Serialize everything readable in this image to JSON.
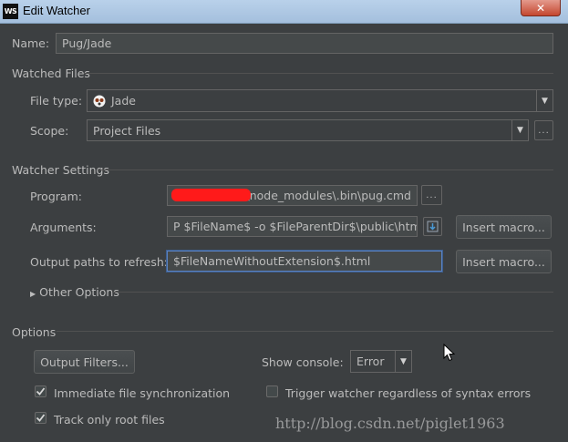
{
  "window": {
    "title": "Edit Watcher",
    "app_icon_text": "WS",
    "close_glyph": "✕"
  },
  "name": {
    "label": "Name:",
    "value": "Pug/Jade"
  },
  "watched_files": {
    "section": "Watched Files",
    "file_type_label": "File type:",
    "file_type_value": "Jade",
    "scope_label": "Scope:",
    "scope_value": "Project Files",
    "more_glyph": "..."
  },
  "watcher_settings": {
    "section": "Watcher Settings",
    "program_label": "Program:",
    "program_value": "\\node_modules\\.bin\\pug.cmd",
    "arguments_label": "Arguments:",
    "arguments_value": "P $FileName$ -o $FileParentDir$\\public\\html\\",
    "output_paths_label": "Output paths to refresh:",
    "output_paths_value": "$FileNameWithoutExtension$.html",
    "insert_macro_label": "Insert macro...",
    "other_options_label": "Other Options"
  },
  "options": {
    "section": "Options",
    "output_filters_label": "Output Filters...",
    "show_console_label": "Show console:",
    "show_console_value": "Error",
    "immediate_sync_label": "Immediate file synchronization",
    "immediate_sync_checked": true,
    "trigger_watcher_label": "Trigger watcher regardless of syntax errors",
    "trigger_watcher_checked": false,
    "track_root_label": "Track only root files",
    "track_root_checked": true
  },
  "watermark": "http://blog.csdn.net/piglet1963"
}
